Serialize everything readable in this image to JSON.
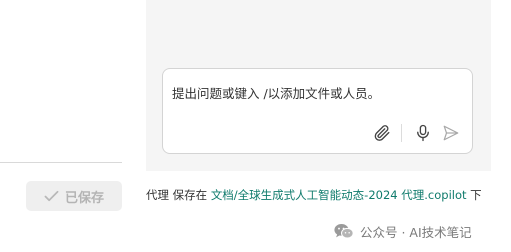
{
  "composer": {
    "placeholder": "提出问题或键入 /以添加文件或人员。",
    "icons": {
      "attach": "paperclip-icon",
      "mic": "microphone-icon",
      "send": "send-icon"
    }
  },
  "save_button": {
    "label": "已保存",
    "icon": "check-icon"
  },
  "save_info": {
    "prefix": "代理 保存在 ",
    "path": "文档/全球生成式人工智能动态-2024 代理.copilot",
    "suffix": " 下"
  },
  "watermark": {
    "text": "公众号 · AI技术笔记",
    "icon": "wechat-icon"
  },
  "colors": {
    "link": "#0f7b6c",
    "panel_bg": "#f5f5f5",
    "disabled_text": "#b4b4b4"
  }
}
